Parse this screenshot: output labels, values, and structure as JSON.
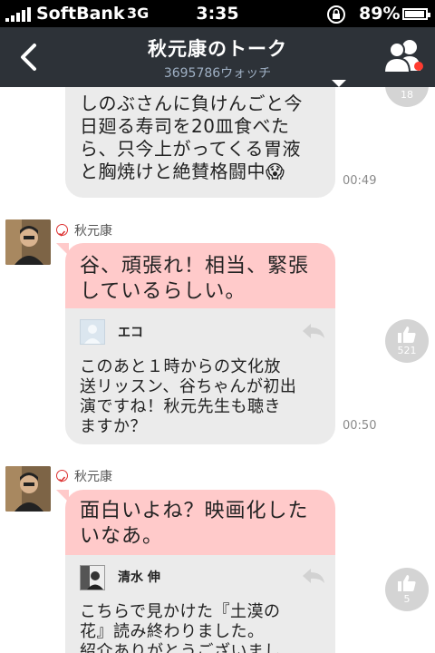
{
  "status_bar": {
    "carrier": "SoftBank",
    "network": "3G",
    "time": "3:35",
    "battery": "89%"
  },
  "header": {
    "title": "秋元康のトーク",
    "subtitle": "3695786ウォッチ"
  },
  "messages": [
    {
      "text": "しのぶさんに負けんごと今\n日廻る寿司を20皿食べた\nら、只今上がってくる胃液\nと胸焼けと絶賛格闘中😱",
      "time": "00:49",
      "likes": "18"
    },
    {
      "sender": "秋元康",
      "reply": "谷、頑張れ！相当、緊張\nしているらしい。",
      "quoted_name": "エコ",
      "quoted_text": "このあと１時からの文化放\n送リッスン、谷ちゃんが初出\n演ですね！秋元先生も聴き\nますか？",
      "time": "00:50",
      "likes": "521"
    },
    {
      "sender": "秋元康",
      "reply": "面白いよね？映画化した\nいなあ。",
      "quoted_name": "清水 伸",
      "quoted_text": "こちらで見かけた『土漠の\n花』読み終わりました。\n紹介ありがとうございまし",
      "likes": "5"
    }
  ],
  "colors": {
    "header_bg": "#2d3238",
    "reply_pink": "#ffcaca",
    "bubble_gray": "#ebebeb",
    "notification": "#ff3b30"
  },
  "icons": [
    "back-chevron-icon",
    "dropdown-arrow-icon",
    "members-icon",
    "verified-check-icon",
    "reply-arrow-icon",
    "thumbs-up-icon"
  ]
}
